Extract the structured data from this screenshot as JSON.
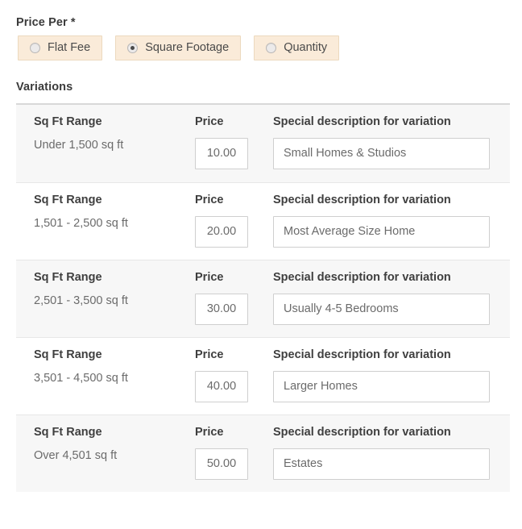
{
  "form": {
    "price_per": {
      "label": "Price Per *",
      "options": [
        {
          "label": "Flat Fee",
          "selected": false
        },
        {
          "label": "Square Footage",
          "selected": true
        },
        {
          "label": "Quantity",
          "selected": false
        }
      ]
    },
    "variations": {
      "title": "Variations",
      "columns": {
        "range": "Sq Ft Range",
        "price": "Price",
        "description": "Special description for variation"
      },
      "rows": [
        {
          "range_label": "Sq Ft Range",
          "range_value": "Under 1,500 sq ft",
          "price_label": "Price",
          "price_value": "10.00",
          "desc_label": "Special description for variation",
          "desc_value": "Small Homes & Studios"
        },
        {
          "range_label": "Sq Ft Range",
          "range_value": "1,501 - 2,500 sq ft",
          "price_label": "Price",
          "price_value": "20.00",
          "desc_label": "Special description for variation",
          "desc_value": "Most Average Size Home"
        },
        {
          "range_label": "Sq Ft Range",
          "range_value": "2,501 - 3,500 sq ft",
          "price_label": "Price",
          "price_value": "30.00",
          "desc_label": "Special description for variation",
          "desc_value": "Usually 4-5 Bedrooms"
        },
        {
          "range_label": "Sq Ft Range",
          "range_value": "3,501 - 4,500 sq ft",
          "price_label": "Price",
          "price_value": "40.00",
          "desc_label": "Special description for variation",
          "desc_value": "Larger Homes"
        },
        {
          "range_label": "Sq Ft Range",
          "range_value": "Over 4,501 sq ft",
          "price_label": "Price",
          "price_value": "50.00",
          "desc_label": "Special description for variation",
          "desc_value": "Estates"
        }
      ]
    }
  },
  "colors": {
    "pill_background": "#faebd9",
    "pill_border": "#ecd9be",
    "row_shaded": "#f7f7f7",
    "input_border": "#cfcfcf",
    "label_text": "#3b3b3b",
    "value_text": "#6b6b6b"
  }
}
